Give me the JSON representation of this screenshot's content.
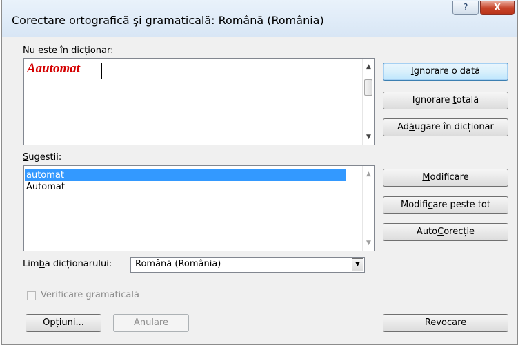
{
  "window": {
    "title": "Corectare ortografică şi gramaticală: Română (România)",
    "help_label": "?",
    "close_label": "X"
  },
  "not_in_dictionary": {
    "label_pre": "Nu ",
    "label_key": "e",
    "label_post": "ste în dicționar:",
    "word": "Aautomat"
  },
  "suggestions": {
    "label_key": "S",
    "label_post": "ugestii:",
    "items": [
      "automat",
      "Automat"
    ],
    "selected_index": 0
  },
  "buttons": {
    "ignore_once": {
      "key": "I",
      "rest": "gnorare o dată"
    },
    "ignore_all": {
      "pre": "Ignorare ",
      "key": "t",
      "rest": "otală"
    },
    "add_dict": {
      "pre": "Ad",
      "key": "ă",
      "rest": "ugare în dicționar"
    },
    "change": {
      "key": "M",
      "rest": "odificare"
    },
    "change_all": {
      "pre": "Modifi",
      "key": "c",
      "rest": "are peste tot"
    },
    "autocorrect": {
      "pre": "Auto",
      "key": "C",
      "rest": "orecție"
    },
    "options": {
      "pre": "O",
      "key": "p",
      "rest": "țiuni..."
    },
    "cancel": "Anulare",
    "undo": "Revocare"
  },
  "dictionary_language": {
    "label_pre": "Lim",
    "label_key": "b",
    "label_post": "a dicționarului:",
    "value": "Română (România)"
  },
  "grammar_check": {
    "label": "Verificare gramaticală",
    "checked": false,
    "enabled": false
  }
}
